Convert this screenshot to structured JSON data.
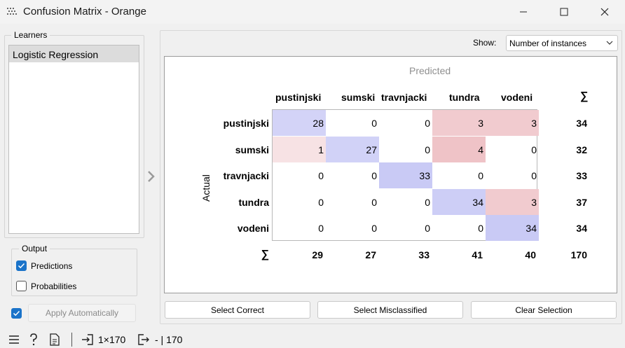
{
  "window": {
    "title": "Confusion Matrix - Orange"
  },
  "learners": {
    "title": "Learners",
    "items": [
      "Logistic Regression"
    ]
  },
  "output": {
    "title": "Output",
    "predictions_label": "Predictions",
    "predictions_checked": true,
    "probabilities_label": "Probabilities",
    "probabilities_checked": false
  },
  "apply": {
    "checked": true,
    "label": "Apply Automatically"
  },
  "show": {
    "label": "Show:",
    "value": "Number of instances"
  },
  "matrix": {
    "predicted_label": "Predicted",
    "actual_label": "Actual",
    "sum_symbol": "∑",
    "classes": [
      "pustinjski",
      "sumski",
      "travnjacki",
      "tundra",
      "vodeni"
    ],
    "values": [
      [
        28,
        0,
        0,
        3,
        3
      ],
      [
        1,
        27,
        0,
        4,
        0
      ],
      [
        0,
        0,
        33,
        0,
        0
      ],
      [
        0,
        0,
        0,
        34,
        3
      ],
      [
        0,
        0,
        0,
        0,
        34
      ]
    ],
    "row_sums": [
      34,
      32,
      33,
      37,
      34
    ],
    "col_sums": [
      29,
      27,
      33,
      41,
      40
    ],
    "total": 170,
    "diag_color": "#c9caf5",
    "misclass_color": "#efc3c7"
  },
  "buttons": {
    "select_correct": "Select Correct",
    "select_misclassified": "Select Misclassified",
    "clear_selection": "Clear Selection"
  },
  "status": {
    "input_summary": "1×170",
    "output_summary": "- | 170"
  }
}
